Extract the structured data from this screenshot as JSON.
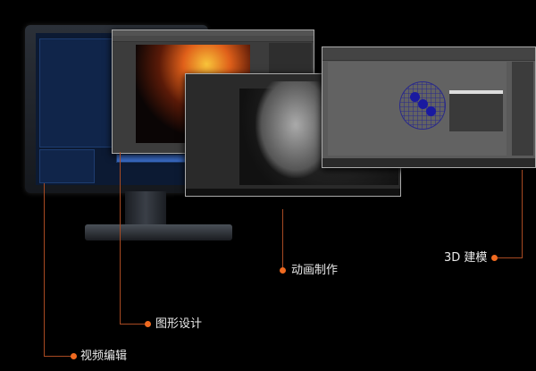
{
  "callouts": {
    "video_editing": "视频编辑",
    "graphic_design": "图形设计",
    "animation": "动画制作",
    "modeling_3d": "3D 建模"
  },
  "colors": {
    "accent": "#f06a20",
    "line": "#a84a22",
    "background": "#000000"
  }
}
